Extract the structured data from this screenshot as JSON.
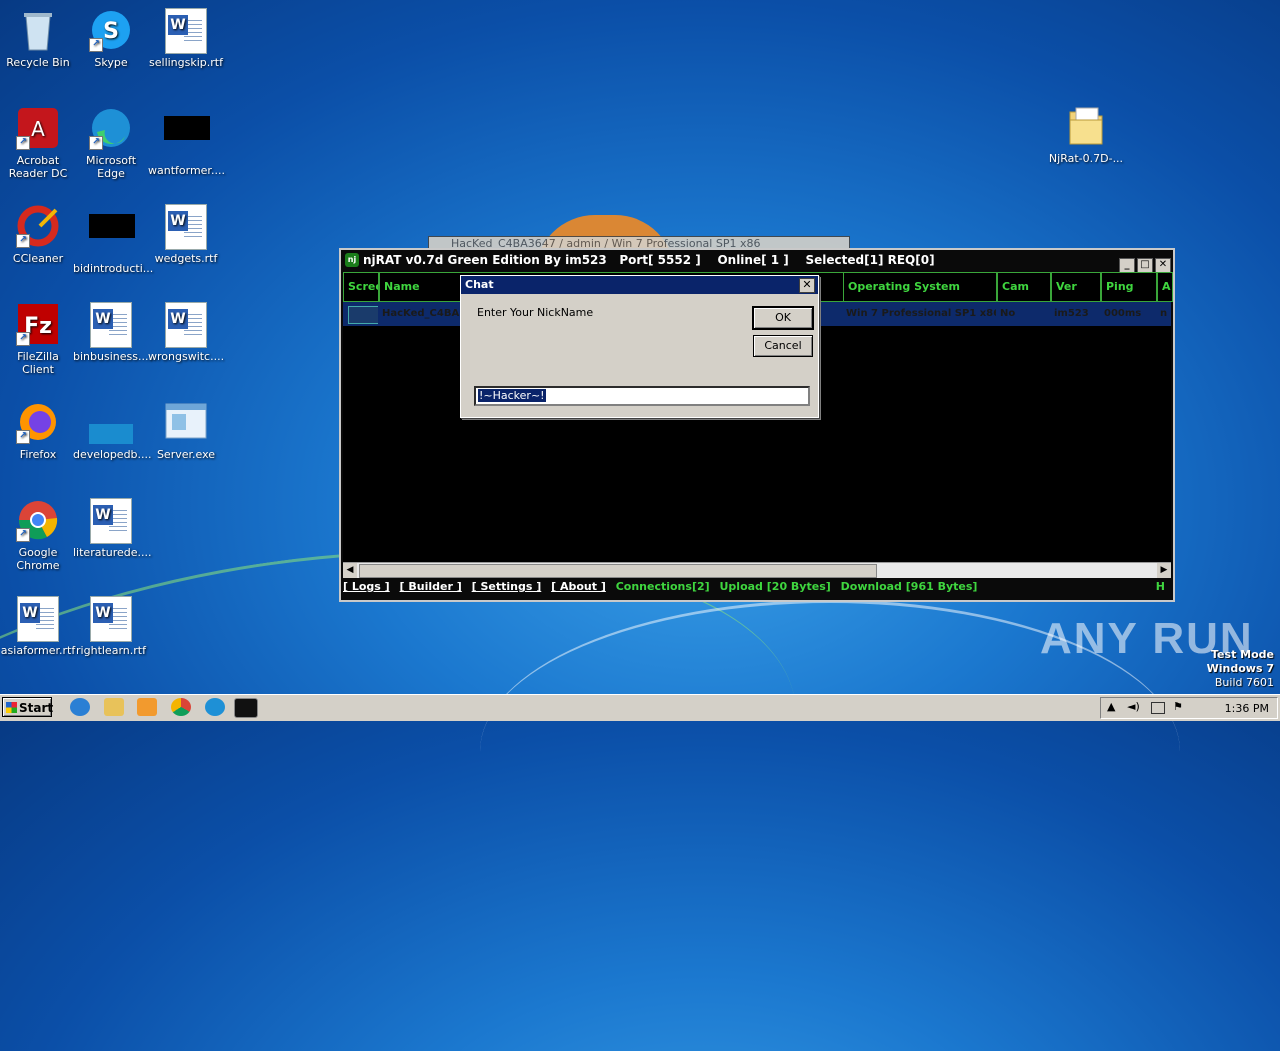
{
  "desktop": {
    "icons": [
      {
        "label": "Recycle Bin",
        "icon": "recycle-bin-icon"
      },
      {
        "label": "Skype",
        "icon": "skype-icon"
      },
      {
        "label": "sellingskip.rtf",
        "icon": "word-doc-icon"
      },
      {
        "label": "Acrobat Reader DC",
        "icon": "acrobat-icon"
      },
      {
        "label": "Microsoft Edge",
        "icon": "edge-icon"
      },
      {
        "label": "wantformer....",
        "icon": "black-file-icon"
      },
      {
        "label": "CCleaner",
        "icon": "ccleaner-icon"
      },
      {
        "label": "bidintroducti...",
        "icon": "black-file-icon"
      },
      {
        "label": "wedgets.rtf",
        "icon": "word-doc-icon"
      },
      {
        "label": "FileZilla Client",
        "icon": "filezilla-icon"
      },
      {
        "label": "binbusiness....",
        "icon": "word-doc-icon"
      },
      {
        "label": "wrongswitc....",
        "icon": "word-doc-icon"
      },
      {
        "label": "Firefox",
        "icon": "firefox-icon"
      },
      {
        "label": "developedb....",
        "icon": "file-icon"
      },
      {
        "label": "Server.exe",
        "icon": "exe-icon"
      },
      {
        "label": "Google Chrome",
        "icon": "chrome-icon"
      },
      {
        "label": "literaturede....",
        "icon": "word-doc-icon"
      },
      {
        "label": "asiaformer.rtf",
        "icon": "word-doc-icon"
      },
      {
        "label": "rightlearn.rtf",
        "icon": "word-doc-icon"
      },
      {
        "label": "NjRat-0.7D-...",
        "icon": "folder-icon"
      }
    ]
  },
  "bg_window": {
    "title": "HacKed_C4BA3647 / admin / Win 7 Professional SP1 x86"
  },
  "njrat": {
    "title": "njRAT v0.7d Green Edition By im523",
    "port": "Port[ 5552 ]",
    "online": "Online[ 1 ]",
    "selected": "Selected[1] REQ[0]",
    "columns": [
      "Screen",
      "Name",
      "Operating System",
      "Cam",
      "Ver",
      "Ping",
      "A"
    ],
    "row": {
      "name": "HacKed_C4BA3",
      "os": "Win 7 Professional SP1 x86",
      "cam": "No",
      "ver": "im523",
      "ping": "000ms",
      "a": "n"
    },
    "footer": {
      "logs": "[ Logs ]",
      "builder": "[ Builder ]",
      "settings": "[ Settings ]",
      "about": "[ About ]",
      "connections": "Connections[2]",
      "upload": "Upload [20 Bytes]",
      "download": "Download [961 Bytes]",
      "h": "H"
    }
  },
  "chat": {
    "title": "Chat",
    "prompt": "Enter Your NickName",
    "ok": "OK",
    "cancel": "Cancel",
    "value": "!~Hacker~!"
  },
  "watermark": "ANY RUN",
  "testmode": {
    "line1": "Test Mode",
    "line2": "Windows 7",
    "line3": "Build 7601"
  },
  "taskbar": {
    "start": "Start",
    "clock": "1:36 PM"
  }
}
